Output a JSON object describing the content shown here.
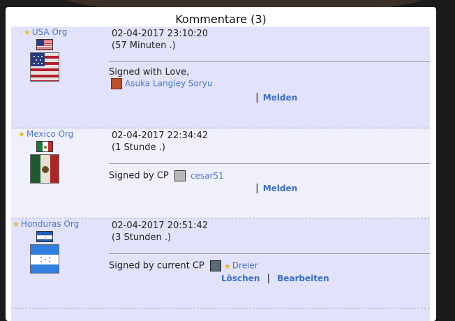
{
  "panel": {
    "title": "Kommentare (3)"
  },
  "comments": [
    {
      "org": "USA Org",
      "datetime": "02-04-2017 23:10:20",
      "ago": "(57 Minuten .)",
      "signature": "Signed with Love,",
      "user": "Asuka Langley Soryu",
      "actions": [
        "Melden"
      ]
    },
    {
      "org": "Mexico Org",
      "datetime": "02-04-2017 22:34:42",
      "ago": "(1 Stunde .)",
      "signature": "Signed by CP",
      "user": "cesar51",
      "actions": [
        "Melden"
      ]
    },
    {
      "org": "Honduras Org",
      "datetime": "02-04-2017 20:51:42",
      "ago": "(3 Stunden .)",
      "signature": "Signed by current CP",
      "user": "Dreier",
      "actions": [
        "Löschen",
        "Bearbeiten"
      ]
    }
  ],
  "colors": {
    "link": "#4a78c8",
    "row_alt_a": "#e2e3fb",
    "row_alt_b": "#f0f0fc",
    "star": "#e8b820"
  },
  "icons": [
    "star-icon",
    "usa-flag-icon",
    "mexico-flag-icon",
    "honduras-flag-icon",
    "avatar-icon"
  ]
}
